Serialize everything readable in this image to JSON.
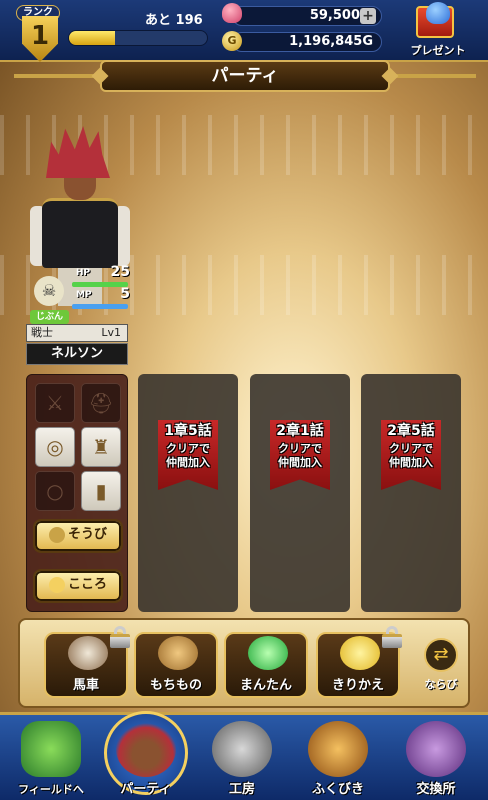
{
  "header": {
    "rank_label": "ランク",
    "rank_value": "1",
    "exp_remaining": "あと 196",
    "exp_progress": 0.33,
    "gems": "59,500こ",
    "gold": "1,196,845G",
    "gold_icon_letter": "G",
    "add_button": "+",
    "present_label": "プレゼント"
  },
  "title": "パーティ",
  "hero": {
    "tag": "じぶん",
    "job": "戦士",
    "level": "Lv1",
    "name": "ネルソン",
    "hp_label": "HP",
    "hp": "25",
    "mp_label": "MP",
    "mp": "5",
    "icon": "skull-crossbones-icon"
  },
  "equipment": {
    "slots": [
      "sword-icon",
      "helmet-icon",
      "shield-icon",
      "armor-icon",
      "ring-icon",
      "boots-icon"
    ],
    "equip_button": "そうび",
    "heart_button": "こころ"
  },
  "recruit_slots": [
    {
      "chapter": "1章5話",
      "line1": "クリアで",
      "line2": "仲間加入"
    },
    {
      "chapter": "2章1話",
      "line1": "クリアで",
      "line2": "仲間加入"
    },
    {
      "chapter": "2章5話",
      "line1": "クリアで",
      "line2": "仲間加入"
    }
  ],
  "actions": {
    "carriage": "馬車",
    "items": "もちもの",
    "easy": "まんたん",
    "switch": "きりかえ",
    "sort": "ならび"
  },
  "nav": {
    "field": "フィールドへ",
    "party": "パーティ",
    "workshop": "工房",
    "lottery": "ふくびき",
    "exchange": "交換所"
  },
  "colors": {
    "accent_gold": "#c9a347",
    "nav_blue": "#1c3a78",
    "flag_red": "#c82828"
  }
}
